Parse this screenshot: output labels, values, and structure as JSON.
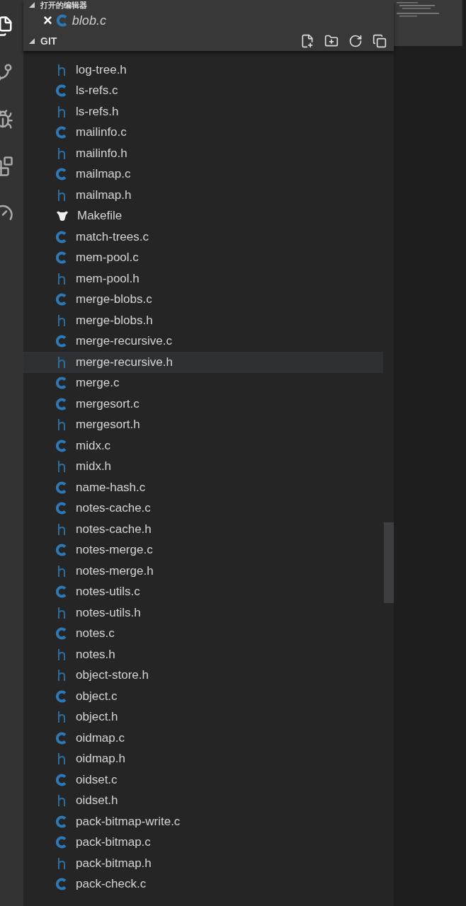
{
  "open_editors": {
    "title": "打开的编辑器",
    "expanded": true,
    "files": [
      {
        "close": "×",
        "name": "blob.c",
        "kind": "c"
      }
    ]
  },
  "folder": {
    "title": "GIT",
    "expanded": true,
    "files": [
      {
        "name": "log-tree.h",
        "kind": "h",
        "hovered": false
      },
      {
        "name": "ls-refs.c",
        "kind": "c",
        "hovered": false
      },
      {
        "name": "ls-refs.h",
        "kind": "h",
        "hovered": false
      },
      {
        "name": "mailinfo.c",
        "kind": "c",
        "hovered": false
      },
      {
        "name": "mailinfo.h",
        "kind": "h",
        "hovered": false
      },
      {
        "name": "mailmap.c",
        "kind": "c",
        "hovered": false
      },
      {
        "name": "mailmap.h",
        "kind": "h",
        "hovered": false
      },
      {
        "name": "Makefile",
        "kind": "make",
        "hovered": false
      },
      {
        "name": "match-trees.c",
        "kind": "c",
        "hovered": false
      },
      {
        "name": "mem-pool.c",
        "kind": "c",
        "hovered": false
      },
      {
        "name": "mem-pool.h",
        "kind": "h",
        "hovered": false
      },
      {
        "name": "merge-blobs.c",
        "kind": "c",
        "hovered": false
      },
      {
        "name": "merge-blobs.h",
        "kind": "h",
        "hovered": false
      },
      {
        "name": "merge-recursive.c",
        "kind": "c",
        "hovered": false
      },
      {
        "name": "merge-recursive.h",
        "kind": "h",
        "hovered": true
      },
      {
        "name": "merge.c",
        "kind": "c",
        "hovered": false
      },
      {
        "name": "mergesort.c",
        "kind": "c",
        "hovered": false
      },
      {
        "name": "mergesort.h",
        "kind": "h",
        "hovered": false
      },
      {
        "name": "midx.c",
        "kind": "c",
        "hovered": false
      },
      {
        "name": "midx.h",
        "kind": "h",
        "hovered": false
      },
      {
        "name": "name-hash.c",
        "kind": "c",
        "hovered": false
      },
      {
        "name": "notes-cache.c",
        "kind": "c",
        "hovered": false
      },
      {
        "name": "notes-cache.h",
        "kind": "h",
        "hovered": false
      },
      {
        "name": "notes-merge.c",
        "kind": "c",
        "hovered": false
      },
      {
        "name": "notes-merge.h",
        "kind": "h",
        "hovered": false
      },
      {
        "name": "notes-utils.c",
        "kind": "c",
        "hovered": false
      },
      {
        "name": "notes-utils.h",
        "kind": "h",
        "hovered": false
      },
      {
        "name": "notes.c",
        "kind": "c",
        "hovered": false
      },
      {
        "name": "notes.h",
        "kind": "h",
        "hovered": false
      },
      {
        "name": "object-store.h",
        "kind": "h",
        "hovered": false
      },
      {
        "name": "object.c",
        "kind": "c",
        "hovered": false
      },
      {
        "name": "object.h",
        "kind": "h",
        "hovered": false
      },
      {
        "name": "oidmap.c",
        "kind": "c",
        "hovered": false
      },
      {
        "name": "oidmap.h",
        "kind": "h",
        "hovered": false
      },
      {
        "name": "oidset.c",
        "kind": "c",
        "hovered": false
      },
      {
        "name": "oidset.h",
        "kind": "h",
        "hovered": false
      },
      {
        "name": "pack-bitmap-write.c",
        "kind": "c",
        "hovered": false
      },
      {
        "name": "pack-bitmap.c",
        "kind": "c",
        "hovered": false
      },
      {
        "name": "pack-bitmap.h",
        "kind": "h",
        "hovered": false
      },
      {
        "name": "pack-check.c",
        "kind": "c",
        "hovered": false
      }
    ]
  }
}
